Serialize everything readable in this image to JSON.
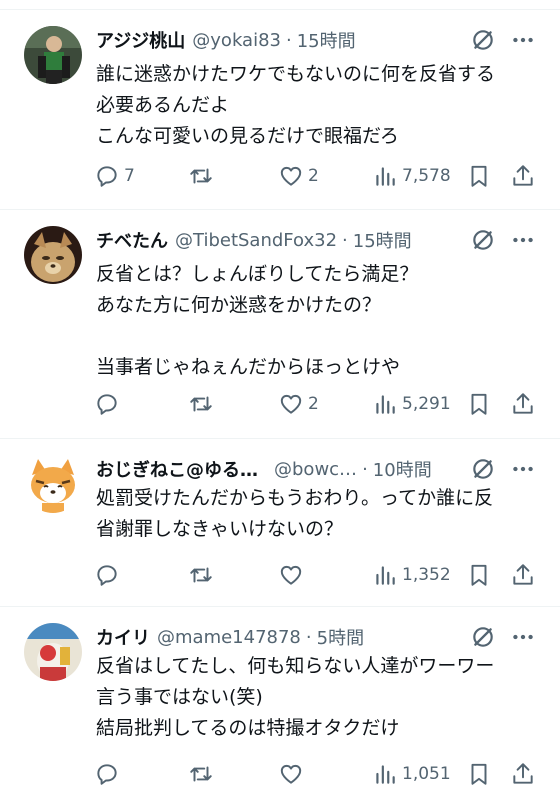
{
  "posts": [
    {
      "name": "アジジ桃山",
      "handle": "@yokai83",
      "dot": "·",
      "time": "15時間",
      "text": "誰に迷惑かけたワケでもないのに何を反省する\n必要あるんだよ\nこんな可愛いの見るだけで眼福だろ",
      "replies": "7",
      "reposts": "",
      "likes": "2",
      "views": "7,578"
    },
    {
      "name": "チベたん",
      "handle": "@TibetSandFox32",
      "dot": "·",
      "time": "15時間",
      "text": "反省とは？しょんぼりしてたら満足？\nあなた方に何か迷惑をかけたの？\n\n当事者じゃねぇんだからほっとけや",
      "replies": "",
      "reposts": "",
      "likes": "2",
      "views": "5,291"
    },
    {
      "name": "おじぎねこ@ゆる…",
      "handle": "@bowc…",
      "dot": "·",
      "time": "10時間",
      "text": "処罰受けたんだからもうおわり。ってか誰に反\n省謝罪しなきゃいけないの？",
      "replies": "",
      "reposts": "",
      "likes": "",
      "views": "1,352"
    },
    {
      "name": "カイリ",
      "handle": "@mame147878",
      "dot": "·",
      "time": "5時間",
      "text": "反省はしてたし、何も知らない人達がワーワー\n言う事ではない(笑)\n結局批判してるのは特撮オタクだけ",
      "replies": "",
      "reposts": "",
      "likes": "",
      "views": "1,051"
    }
  ],
  "icons": {
    "grok": "grok-icon",
    "more": "more-icon",
    "reply": "reply-icon",
    "repost": "repost-icon",
    "like": "heart-icon",
    "views": "views-icon",
    "bookmark": "bookmark-icon",
    "share": "share-icon"
  },
  "colors": {
    "text": "#0f1419",
    "secondary": "#536471",
    "divider": "#eff3f4"
  }
}
